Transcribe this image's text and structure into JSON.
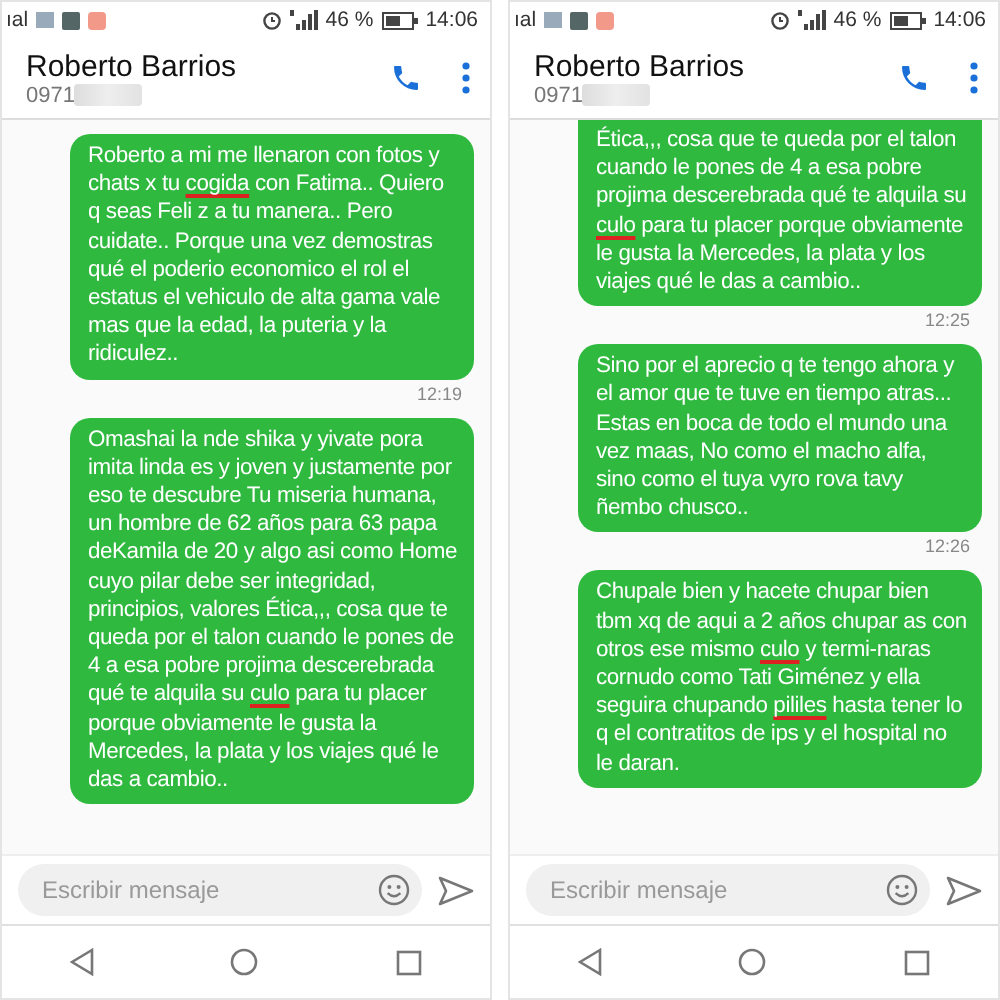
{
  "screens": [
    {
      "status_bar": {
        "carrier": "ıal",
        "battery": "46 %",
        "time": "14:06"
      },
      "header": {
        "contact_name": "Roberto Barrios",
        "phone_number": "0971"
      },
      "messages": [
        {
          "clipped": false,
          "time": "12:19",
          "parts": [
            {
              "kind": "plain",
              "text": "Roberto a mi me llenaron con fotos y chats x tu "
            },
            {
              "kind": "censored",
              "text": "cogida"
            },
            {
              "kind": "plain",
              "text": " con Fatima.. Quiero q seas Feli z a tu manera.. Pero cuidate.. Porque una vez demostras qué el poderio economico el rol el estatus el vehiculo de alta gama vale mas que la edad, la puteria y la ridiculez.."
            }
          ]
        },
        {
          "clipped": false,
          "parts": [
            {
              "kind": "plain",
              "text": "Omashai la nde shika y yivate pora imita linda es y joven y justamente por eso te descubre Tu miseria humana, un hombre de 62 años para 63 papa deKamila de 20 y algo asi como Home cuyo pilar debe ser integridad, principios, valores Ética,,, cosa que te queda por el talon cuando le pones de 4 a esa pobre projima descerebrada qué te alquila su "
            },
            {
              "kind": "censored",
              "text": "culo"
            },
            {
              "kind": "plain",
              "text": " para tu placer porque obviamente le gusta la Mercedes, la plata  y los viajes qué le das a cambio.."
            }
          ]
        }
      ],
      "composer": {
        "placeholder": "Escribir mensaje"
      }
    },
    {
      "status_bar": {
        "carrier": "ıal",
        "battery": "46 %",
        "time": "14:06"
      },
      "header": {
        "contact_name": "Roberto Barrios",
        "phone_number": "0971"
      },
      "messages": [
        {
          "clipped": true,
          "time": "12:25",
          "parts": [
            {
              "kind": "plain",
              "text": "Ética,,, cosa que te queda por el talon cuando le pones de 4 a esa pobre projima descerebrada qué te alquila su "
            },
            {
              "kind": "censored",
              "text": "culo"
            },
            {
              "kind": "plain",
              "text": " para tu placer porque obviamente le gusta la Mercedes, la plata  y los viajes qué le das a cambio.."
            }
          ]
        },
        {
          "clipped": false,
          "time": "12:26",
          "parts": [
            {
              "kind": "plain",
              "text": "Sino por el aprecio q te tengo ahora y el amor que te tuve en tiempo atras... Estas en boca de todo el mundo una vez maas, No como el macho alfa, sino como el tuya vyro rova tavy ñembo chusco.."
            }
          ]
        },
        {
          "clipped": false,
          "parts": [
            {
              "kind": "plain",
              "text": "Chupale bien y hacete chupar bien tbm xq de aqui a 2 años chupar as con otros ese mismo "
            },
            {
              "kind": "censored",
              "text": "culo"
            },
            {
              "kind": "plain",
              "text": " y termi-naras cornudo como Tati Giménez y ella seguira chupando "
            },
            {
              "kind": "censored",
              "text": "pililes"
            },
            {
              "kind": "plain",
              "text": " hasta tener lo q el contratitos de ips y el hospital no le daran."
            }
          ]
        }
      ],
      "composer": {
        "placeholder": "Escribir mensaje"
      }
    }
  ]
}
